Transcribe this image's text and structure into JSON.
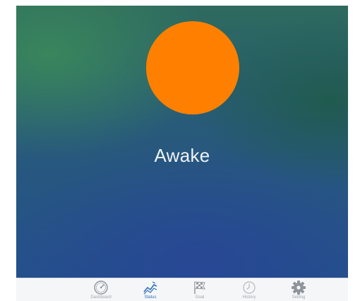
{
  "status": {
    "state_label": "Awake",
    "indicator_color": "#ff8000"
  },
  "tabbar": {
    "tabs": [
      {
        "label": "Dashboard",
        "icon": "gauge-icon",
        "active": false
      },
      {
        "label": "Status",
        "icon": "trend-icon",
        "active": true
      },
      {
        "label": "Goal",
        "icon": "checkered-flag-icon",
        "active": false
      },
      {
        "label": "History",
        "icon": "clock-icon",
        "active": false
      },
      {
        "label": "Setting",
        "icon": "gear-icon",
        "active": false
      }
    ]
  },
  "colors": {
    "active_tab": "#2f6fb8",
    "inactive_tab": "#a0a6ad",
    "tabbar_bg": "#f4f6f8"
  }
}
